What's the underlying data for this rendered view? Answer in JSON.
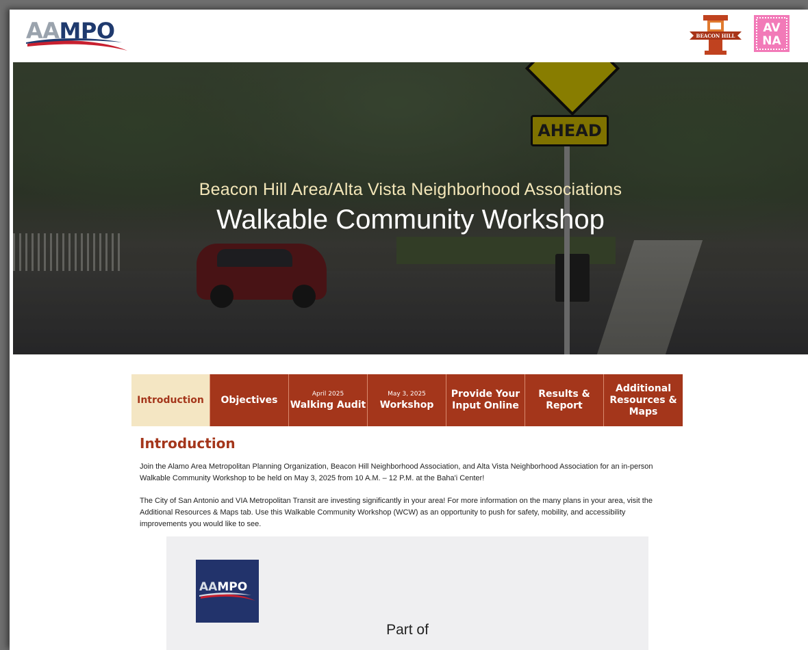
{
  "header": {
    "logo_left": {
      "part1": "AA",
      "part2": "MPO"
    },
    "logo_beacon_hill": "BEACON HILL",
    "logo_avna": {
      "line1": "AV",
      "line2": "NA"
    }
  },
  "hero": {
    "subtitle": "Beacon Hill Area/Alta Vista Neighborhood Associations",
    "title": "Walkable Community Workshop",
    "sign_text": "AHEAD"
  },
  "tabs": [
    {
      "small": "",
      "label": "Introduction"
    },
    {
      "small": "",
      "label": "Objectives"
    },
    {
      "small": "April 2025",
      "label": "Walking Audit"
    },
    {
      "small": "May 3, 2025",
      "label": "Workshop"
    },
    {
      "small": "",
      "label": "Provide Your Input Online"
    },
    {
      "small": "",
      "label": "Results & Report"
    },
    {
      "small": "",
      "label": "Additional Resources & Maps"
    }
  ],
  "content": {
    "heading": "Introduction",
    "para1": "Join the Alamo Area Metropolitan Planning Organization, Beacon Hill Neighborhood Association, and Alta Vista Neighborhood Association for an in-person Walkable Community Workshop to be held on May 3, 2025 from 10 A.M. – 12 P.M. at the Baha'i Center!",
    "para2": "The City of San Antonio and VIA Metropolitan Transit are investing significantly in your area! For more information on the many plans in your area, visit the Additional Resources & Maps tab. Use this Walkable Community Workshop (WCW) as an opportunity to push for safety, mobility, and accessibility improvements you would like to see."
  },
  "card": {
    "logo": {
      "part1": "AA",
      "part2": "MPO"
    },
    "part_of": "Part of"
  },
  "colors": {
    "brand": "#a4361b",
    "active_tab_bg": "#f4e6c3",
    "hero_subtitle": "#f3e6b8",
    "aampo_navy": "#22336b"
  }
}
